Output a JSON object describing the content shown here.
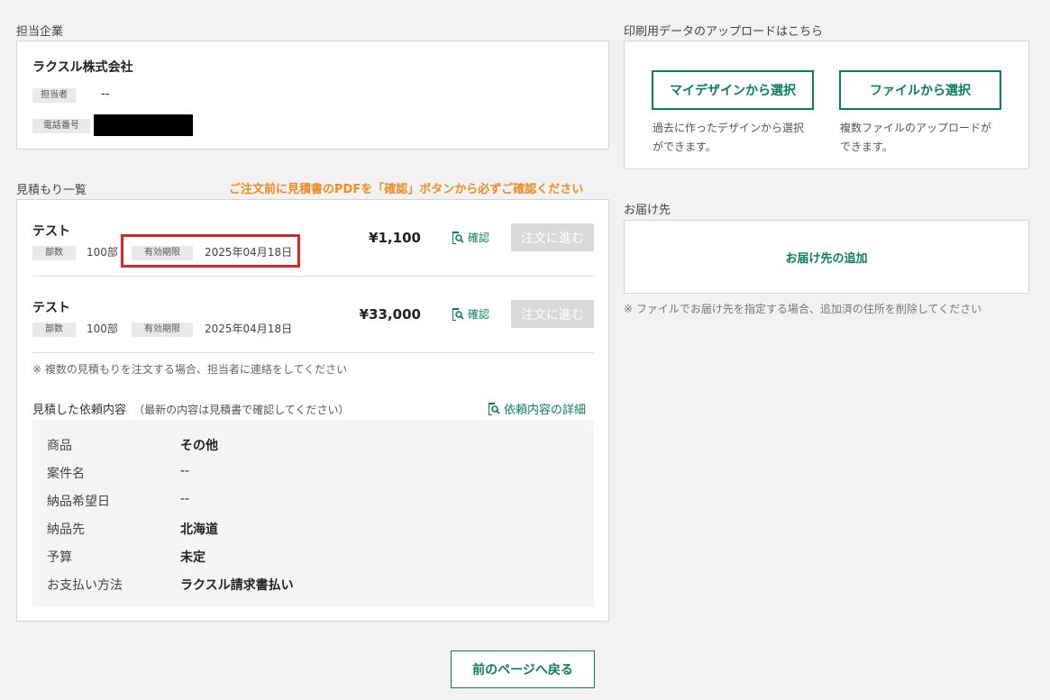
{
  "company": {
    "section_label": "担当企業",
    "name": "ラクスル株式会社",
    "person_tag": "担当者",
    "person_value": "--",
    "phone_tag": "電話番号"
  },
  "upload": {
    "section_label": "印刷用データのアップロードはこちら",
    "my_design_button": "マイデザインから選択",
    "my_design_desc_1": "過去に作ったデザインから選択",
    "my_design_desc_2": "ができます。",
    "file_button": "ファイルから選択",
    "file_desc_1": "複数ファイルのアップロードが",
    "file_desc_2": "できます。"
  },
  "quotes": {
    "section_label": "見積もり一覧",
    "warning": "ご注文前に見積書のPDFを「確認」ボタンから必ずご確認ください",
    "items": [
      {
        "name": "テスト",
        "qty_tag": "部数",
        "qty": "100部",
        "expiry_tag": "有効期限",
        "expiry": "2025年04月18日",
        "price": "¥1,100",
        "confirm": "確認",
        "order": "注文に進む"
      },
      {
        "name": "テスト",
        "qty_tag": "部数",
        "qty": "100部",
        "expiry_tag": "有効期限",
        "expiry": "2025年04月18日",
        "price": "¥33,000",
        "confirm": "確認",
        "order": "注文に進む"
      }
    ],
    "note": "※ 複数の見積もりを注文する場合、担当者に連絡をしてください",
    "request_title": "見積した依頼内容",
    "request_sub": "（最新の内容は見積書で確認してください）",
    "request_detail_link": "依頼内容の詳細",
    "details": [
      {
        "label": "商品",
        "value": "その他",
        "bold": true
      },
      {
        "label": "案件名",
        "value": "--",
        "bold": false
      },
      {
        "label": "納品希望日",
        "value": "--",
        "bold": false
      },
      {
        "label": "納品先",
        "value": "北海道",
        "bold": true
      },
      {
        "label": "予算",
        "value": "未定",
        "bold": true
      },
      {
        "label": "お支払い方法",
        "value": "ラクスル請求書払い",
        "bold": true
      }
    ]
  },
  "delivery": {
    "section_label": "お届け先",
    "add_link": "お届け先の追加",
    "note": "※ ファイルでお届け先を指定する場合、追加済の住所を削除してください"
  },
  "back_button": "前のページへ戻る",
  "colors": {
    "accent": "#0a7e63",
    "warning": "#f08a24",
    "highlight": "#d9262b"
  }
}
